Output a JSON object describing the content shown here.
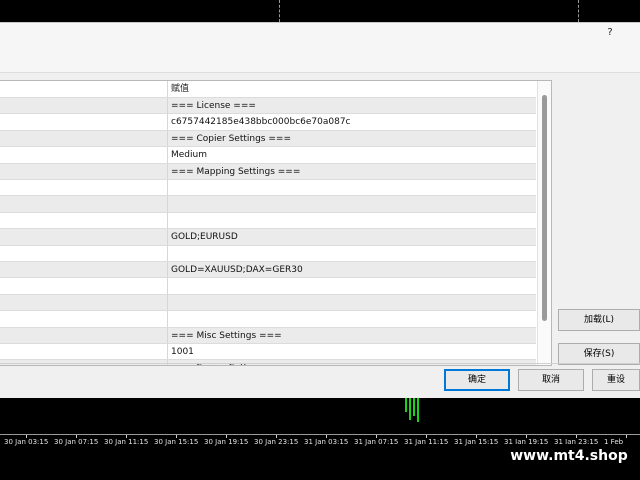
{
  "dialog": {
    "help_label": "?"
  },
  "grid": {
    "header_value": "赋值",
    "rows": [
      "=== License ===",
      "c6757442185e438bbc000bc6e70a087c",
      "=== Copier Settings ===",
      "Medium",
      "=== Mapping Settings ===",
      "",
      "",
      "",
      "GOLD;EURUSD",
      "",
      "GOLD=XAUUSD;DAX=GER30",
      "",
      "",
      "",
      "=== Misc Settings ===",
      "1001",
      "=== Server Settings ==="
    ]
  },
  "buttons": {
    "load": "加载(L)",
    "save": "保存(S)",
    "ok": "确定",
    "cancel": "取消",
    "reset": "重设"
  },
  "chart": {
    "time_labels": [
      "30 Jan 03:15",
      "30 Jan 07:15",
      "30 Jan 11:15",
      "30 Jan 15:15",
      "30 Jan 19:15",
      "30 Jan 23:15",
      "31 Jan 03:15",
      "31 Jan 07:15",
      "31 Jan 11:15",
      "31 Jan 15:15",
      "31 Jan 19:15",
      "31 Jan 23:15",
      "1 Feb"
    ],
    "candle_color": "#1ad21a"
  },
  "watermark": "www.mt4.shop"
}
